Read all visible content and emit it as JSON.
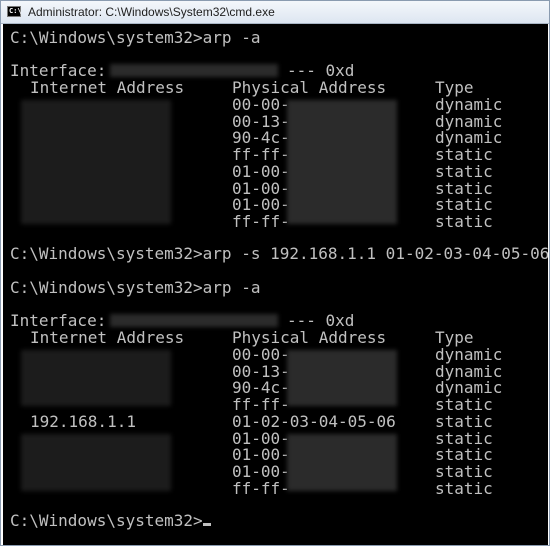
{
  "window": {
    "title": "Administrator: C:\\Windows\\System32\\cmd.exe",
    "icon": "cmd-icon",
    "icon_text": "C:\\"
  },
  "console": {
    "prompt1": "C:\\Windows\\system32>arp -a",
    "block1": {
      "interface_label": "Interface:",
      "interface_suffix": "--- 0xd",
      "col_internet": "Internet Address",
      "col_physical": "Physical Address",
      "col_type": "Type",
      "rows": [
        {
          "ip": "",
          "mac": "00-00-",
          "type": "dynamic"
        },
        {
          "ip": "",
          "mac": "00-13-",
          "type": "dynamic"
        },
        {
          "ip": "",
          "mac": "90-4c-",
          "type": "dynamic"
        },
        {
          "ip": "",
          "mac": "ff-ff-",
          "type": "static"
        },
        {
          "ip": "",
          "mac": "01-00-",
          "type": "static"
        },
        {
          "ip": "",
          "mac": "01-00-",
          "type": "static"
        },
        {
          "ip": "",
          "mac": "01-00-",
          "type": "static"
        },
        {
          "ip": "",
          "mac": "ff-ff-",
          "type": "static"
        }
      ]
    },
    "prompt2": "C:\\Windows\\system32>arp -s 192.168.1.1 01-02-03-04-05-06",
    "prompt3": "C:\\Windows\\system32>arp -a",
    "block2": {
      "interface_label": "Interface:",
      "interface_suffix": "--- 0xd",
      "col_internet": "Internet Address",
      "col_physical": "Physical Address",
      "col_type": "Type",
      "rows": [
        {
          "ip": "",
          "mac": "00-00-",
          "type": "dynamic"
        },
        {
          "ip": "",
          "mac": "00-13-",
          "type": "dynamic"
        },
        {
          "ip": "",
          "mac": "90-4c-",
          "type": "dynamic"
        },
        {
          "ip": "",
          "mac": "ff-ff-",
          "type": "static"
        },
        {
          "ip": "192.168.1.1",
          "mac": "01-02-03-04-05-06",
          "type": "static"
        },
        {
          "ip": "",
          "mac": "01-00-",
          "type": "static"
        },
        {
          "ip": "",
          "mac": "01-00-",
          "type": "static"
        },
        {
          "ip": "",
          "mac": "01-00-",
          "type": "static"
        },
        {
          "ip": "",
          "mac": "ff-ff-",
          "type": "static"
        }
      ]
    },
    "prompt4": "C:\\Windows\\system32>"
  }
}
